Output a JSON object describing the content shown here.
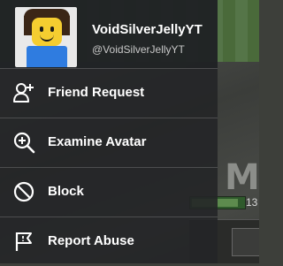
{
  "profile": {
    "display_name": "VoidSilverJellyYT",
    "username": "@VoidSilverJellyYT"
  },
  "menu": {
    "items": [
      {
        "label": "Friend Request",
        "icon": "add-friend-icon"
      },
      {
        "label": "Examine Avatar",
        "icon": "zoom-in-icon"
      },
      {
        "label": "Block",
        "icon": "block-icon"
      },
      {
        "label": "Report Abuse",
        "icon": "flag-icon"
      }
    ]
  },
  "hud": {
    "letter": "M",
    "number": "13"
  },
  "colors": {
    "menu_bg": "#232527",
    "text": "#ffffff",
    "username_text": "#c8c8c8",
    "avatar_head": "#f5cd30",
    "avatar_torso": "#2f7ce0",
    "avatar_hair": "#3b2616"
  }
}
